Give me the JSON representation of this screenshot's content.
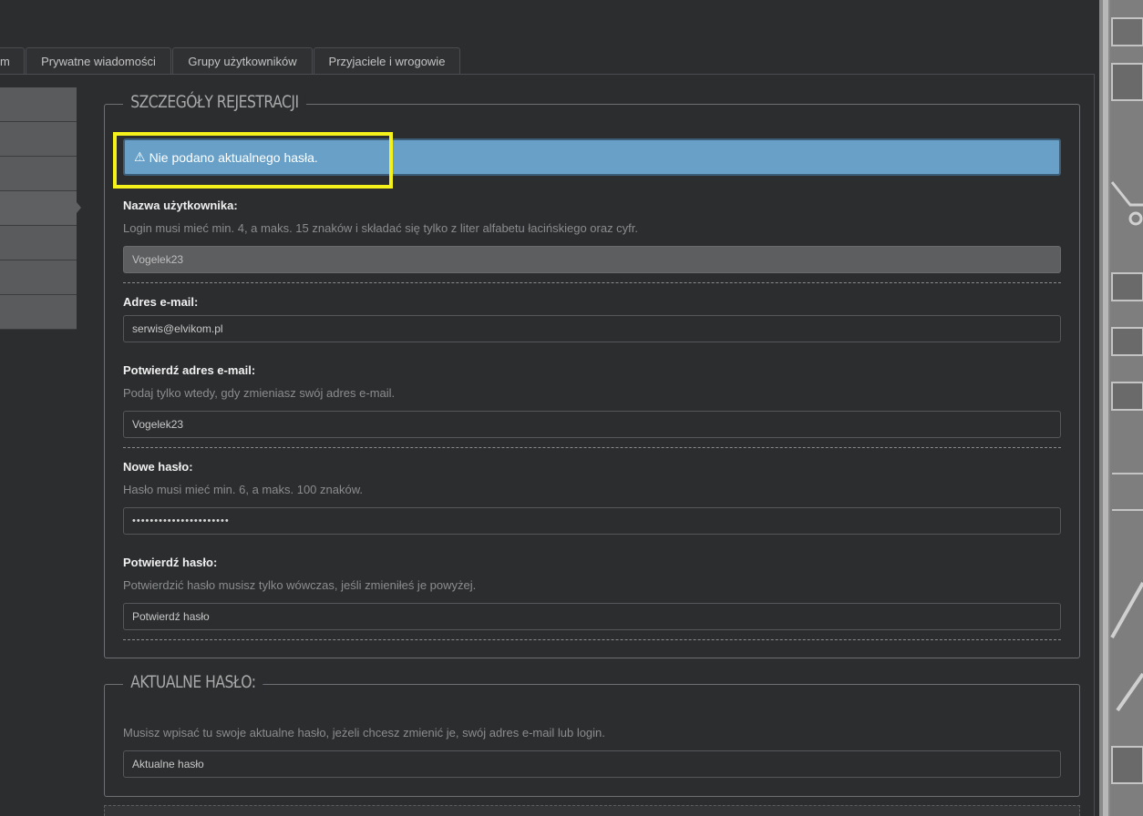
{
  "tabs": [
    {
      "label": "m"
    },
    {
      "label": "Prywatne wiadomości"
    },
    {
      "label": "Grupy użytkowników"
    },
    {
      "label": "Przyjaciele i wrogowie"
    }
  ],
  "registration": {
    "legend": "Szczegóły rejestracji",
    "alert": {
      "icon": "warning-icon",
      "text": "Nie podano aktualnego hasła.",
      "color": "#68a0c8"
    },
    "username": {
      "label": "Nazwa użytkownika:",
      "hint": "Login musi mieć min. 4, a maks. 15 znaków i składać się tylko z liter alfabetu łacińskiego oraz cyfr.",
      "value": "Vogelek23"
    },
    "email": {
      "label": "Adres e-mail:",
      "value": "serwis@elvikom.pl"
    },
    "confirm_email": {
      "label": "Potwierdź adres e-mail:",
      "hint": "Podaj tylko wtedy, gdy zmieniasz swój adres e-mail.",
      "value": "Vogelek23"
    },
    "new_password": {
      "label": "Nowe hasło:",
      "hint": "Hasło musi mieć min. 6, a maks. 100 znaków.",
      "value": "••••••••••••••••••••••"
    },
    "confirm_password": {
      "label": "Potwierdź hasło:",
      "hint": "Potwierdzić hasło musisz tylko wówczas, jeśli zmieniłeś je powyżej.",
      "placeholder": "Potwierdź hasło"
    }
  },
  "current_password": {
    "legend": "Aktualne hasło:",
    "hint": "Musisz wpisać tu swoje aktualne hasło, jeżeli chcesz zmienić je, swój adres e-mail lub login.",
    "placeholder": "Aktualne hasło"
  },
  "highlight_color": "#f4f11b"
}
